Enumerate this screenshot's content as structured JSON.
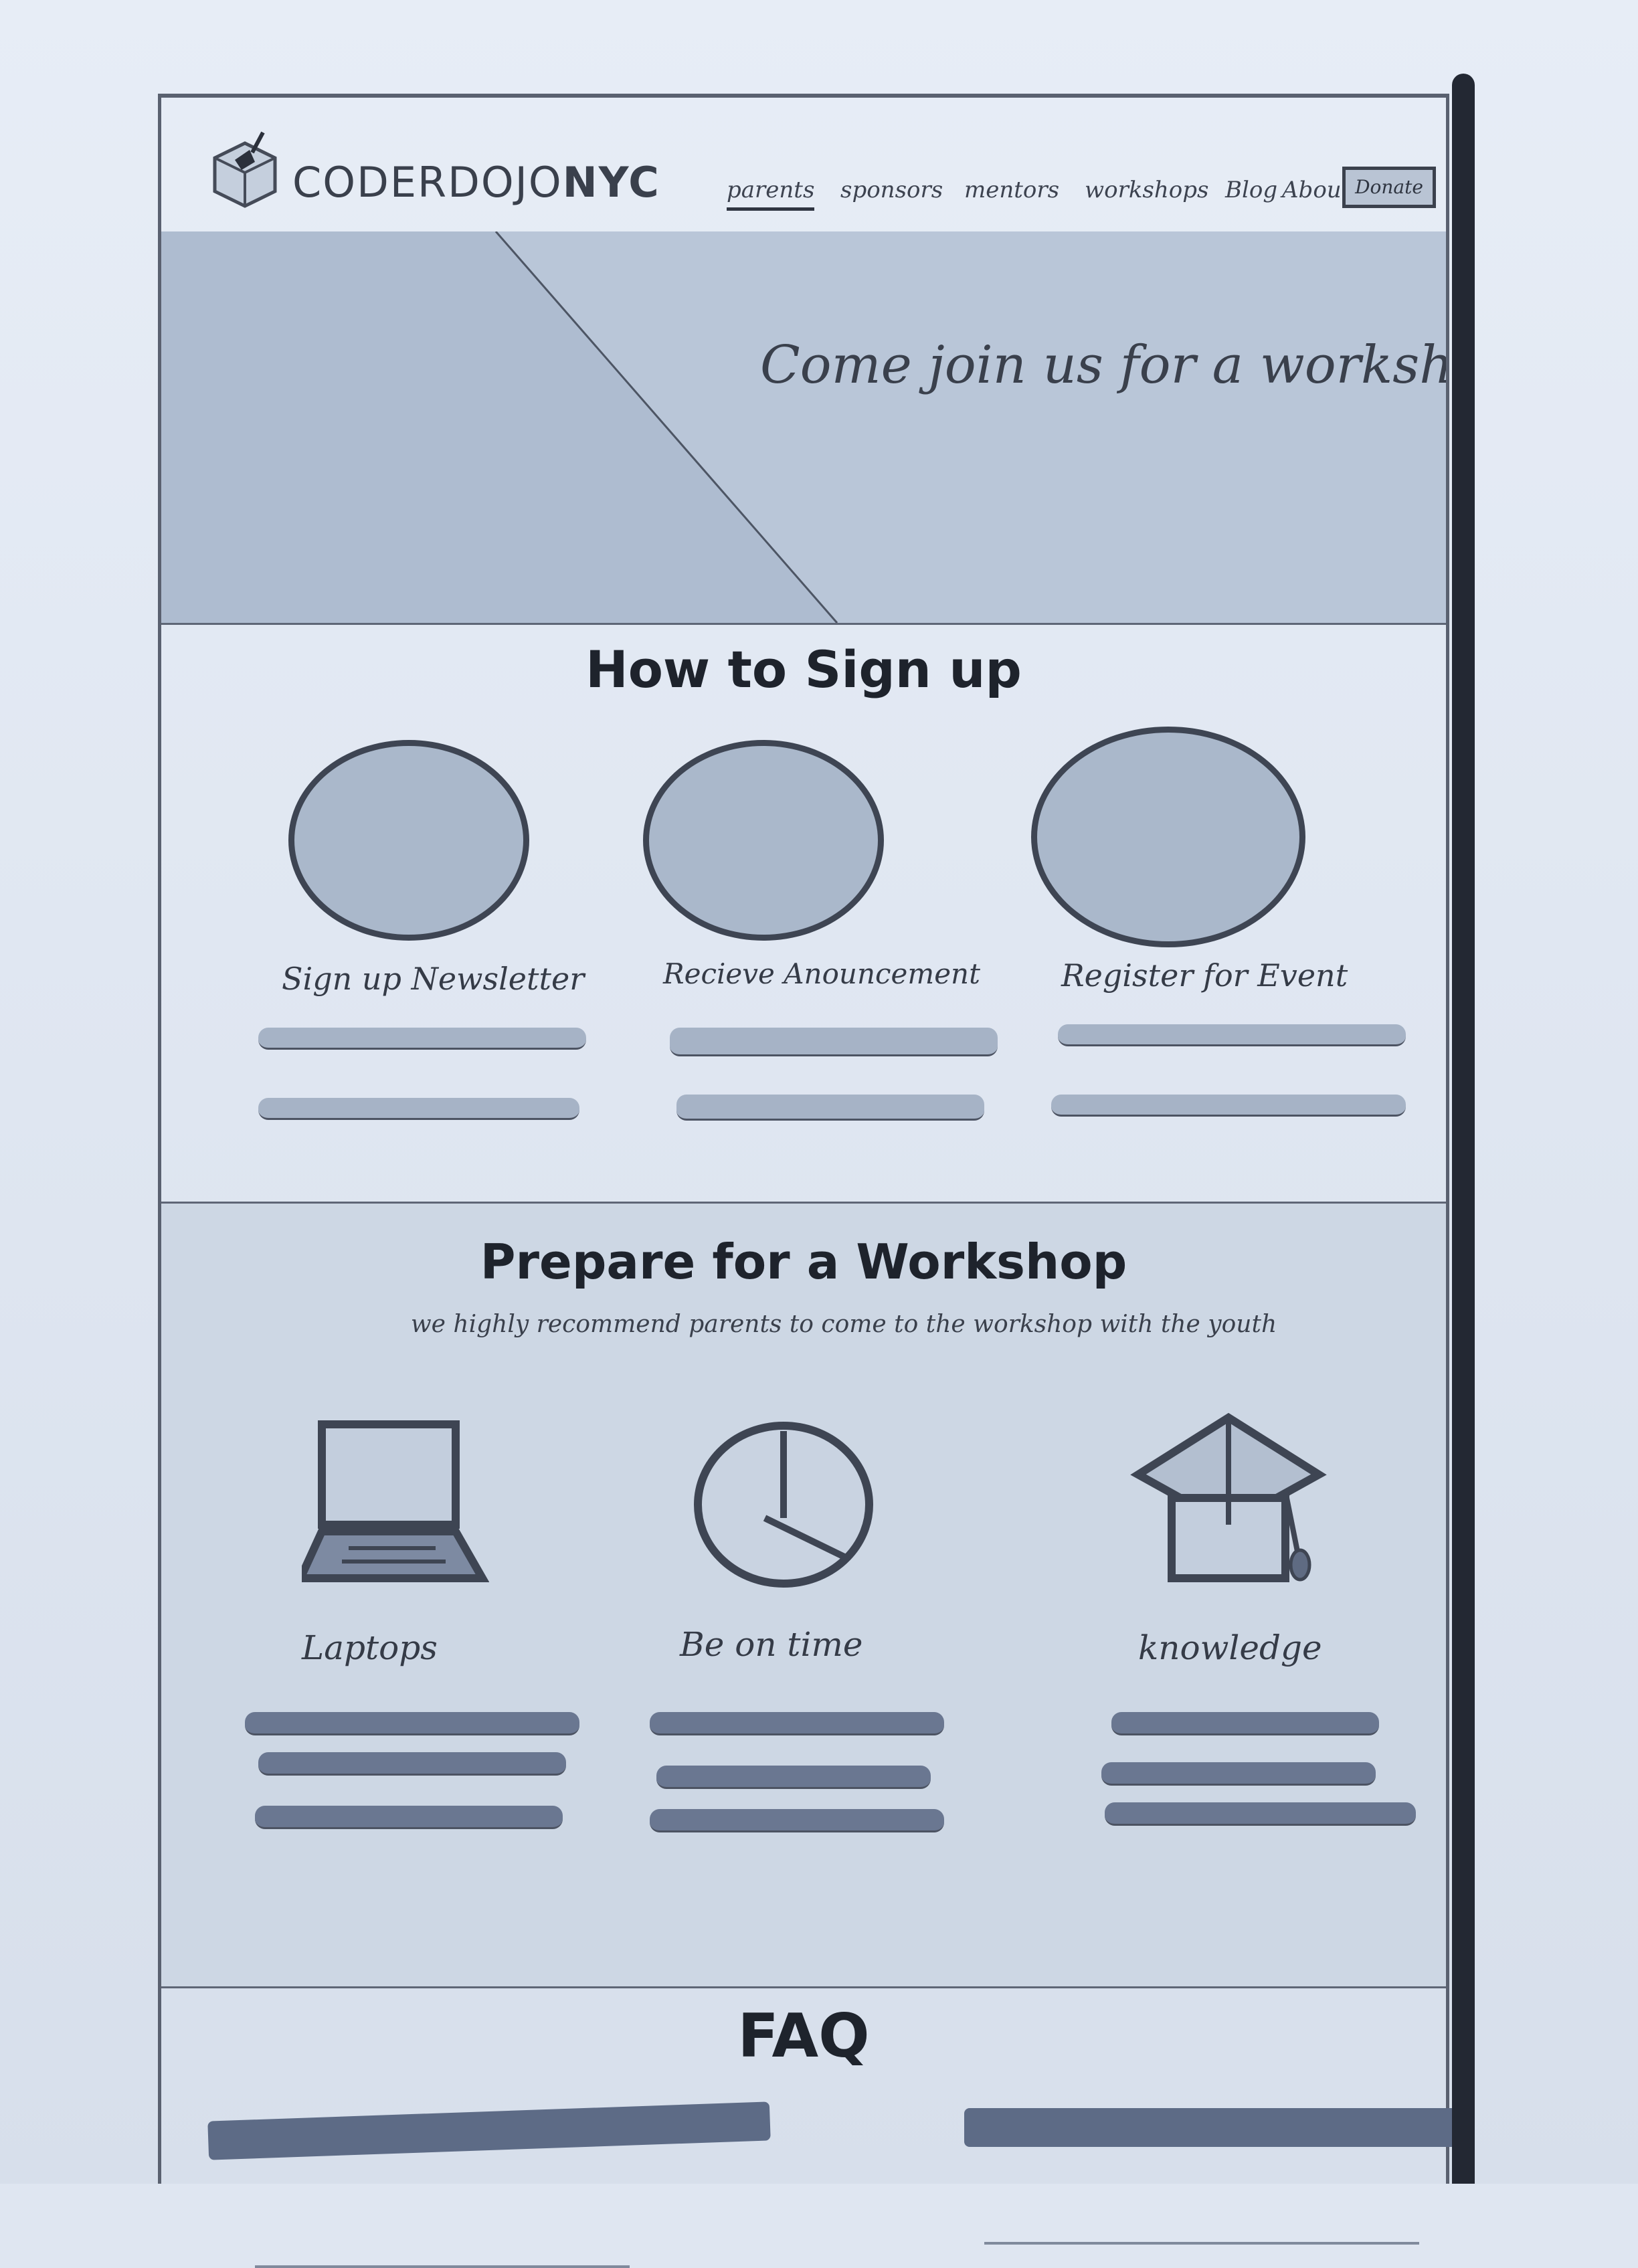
{
  "header": {
    "logo_text_light": "CODERDOJO",
    "logo_text_bold": "NYC",
    "nav": [
      {
        "label": "parents",
        "active": true
      },
      {
        "label": "sponsors",
        "active": false
      },
      {
        "label": "mentors",
        "active": false
      },
      {
        "label": "workshops",
        "active": false
      },
      {
        "label": "Blog",
        "active": false
      },
      {
        "label": "About",
        "active": false
      }
    ],
    "donate_label": "Donate"
  },
  "hero": {
    "title": "Come join us for a workshop!"
  },
  "signup": {
    "title": "How to Sign up",
    "steps": [
      {
        "label": "Sign up Newsletter"
      },
      {
        "label": "Recieve Anouncement"
      },
      {
        "label": "Register for Event"
      }
    ]
  },
  "prepare": {
    "title": "Prepare for a Workshop",
    "subtitle": "we highly recommend parents to come to the workshop with the youth",
    "items": [
      {
        "label": "Laptops",
        "icon": "laptop-icon"
      },
      {
        "label": "Be on time",
        "icon": "clock-icon"
      },
      {
        "label": "knowledge",
        "icon": "graduation-cap-icon"
      }
    ]
  },
  "faq": {
    "title": "FAQ"
  },
  "colors": {
    "ink": "#2d3340",
    "wash": "#b9c6d8",
    "marker": "#5d6b86",
    "scrollbar": "#232833"
  }
}
